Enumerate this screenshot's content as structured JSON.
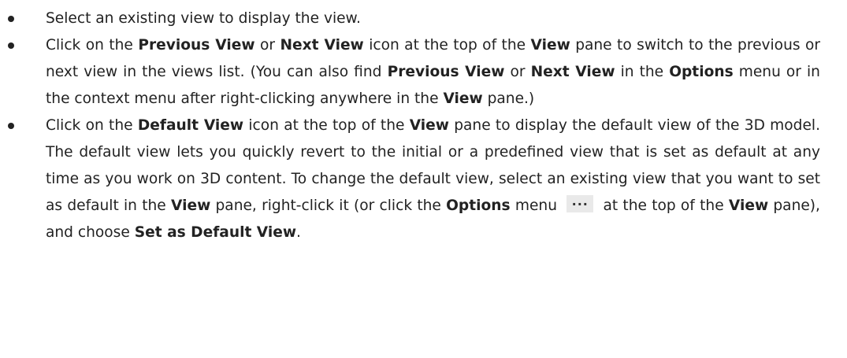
{
  "bullets": [
    {
      "parts": [
        {
          "t": "Select an existing view to display the view."
        }
      ]
    },
    {
      "parts": [
        {
          "t": "Click on the "
        },
        {
          "t": "Previous View",
          "b": true
        },
        {
          "t": " or "
        },
        {
          "t": "Next View",
          "b": true
        },
        {
          "t": " icon at the top of the "
        },
        {
          "t": "View",
          "b": true
        },
        {
          "t": " pane to switch to the previous or next view in the views list. (You can also find "
        },
        {
          "t": "Previous View",
          "b": true
        },
        {
          "t": " or "
        },
        {
          "t": "Next View",
          "b": true
        },
        {
          "t": " in the "
        },
        {
          "t": "Options",
          "b": true
        },
        {
          "t": " menu or in the context menu after right-clicking anywhere in the "
        },
        {
          "t": "View",
          "b": true
        },
        {
          "t": " pane.)"
        }
      ]
    },
    {
      "parts": [
        {
          "t": "Click on the "
        },
        {
          "t": "Default View",
          "b": true
        },
        {
          "t": " icon at the top of the "
        },
        {
          "t": "View",
          "b": true
        },
        {
          "t": " pane to display the default view of the 3D model. The default view lets you quickly revert to the initial or a predefined view that is set as default at any time as you work on 3D content. To change the default view, select an existing view that you want to set as default in the "
        },
        {
          "t": "View",
          "b": true
        },
        {
          "t": " pane, right-click it (or click the "
        },
        {
          "t": "Options",
          "b": true
        },
        {
          "t": " menu "
        },
        {
          "icon": "more-options-icon",
          "glyph": "···"
        },
        {
          "t": " at the top of the "
        },
        {
          "t": "View",
          "b": true
        },
        {
          "t": " pane), and choose "
        },
        {
          "t": "Set as Default View",
          "b": true
        },
        {
          "t": "."
        }
      ]
    }
  ]
}
